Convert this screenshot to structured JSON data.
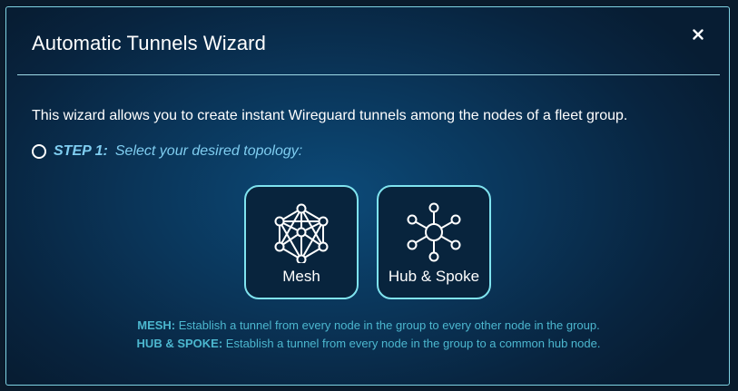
{
  "dialog": {
    "title": "Automatic Tunnels Wizard",
    "close_icon": "close-icon"
  },
  "intro": "This wizard allows you to create instant Wireguard tunnels among the nodes of a fleet group.",
  "step": {
    "label": "STEP 1:",
    "text": "Select your desired topology:"
  },
  "options": [
    {
      "label": "Mesh",
      "icon": "mesh-topology-icon"
    },
    {
      "label": "Hub & Spoke",
      "icon": "hub-spoke-topology-icon"
    }
  ],
  "descriptions": [
    {
      "term": "MESH:",
      "text": "Establish a tunnel from every node in the group to every other node in the group."
    },
    {
      "term": "HUB & SPOKE:",
      "text": "Establish a tunnel from every node in the group to a common hub node."
    }
  ],
  "colors": {
    "border": "#7fd3e3",
    "accent": "#7fcdf0",
    "description": "#4cb7cf"
  }
}
